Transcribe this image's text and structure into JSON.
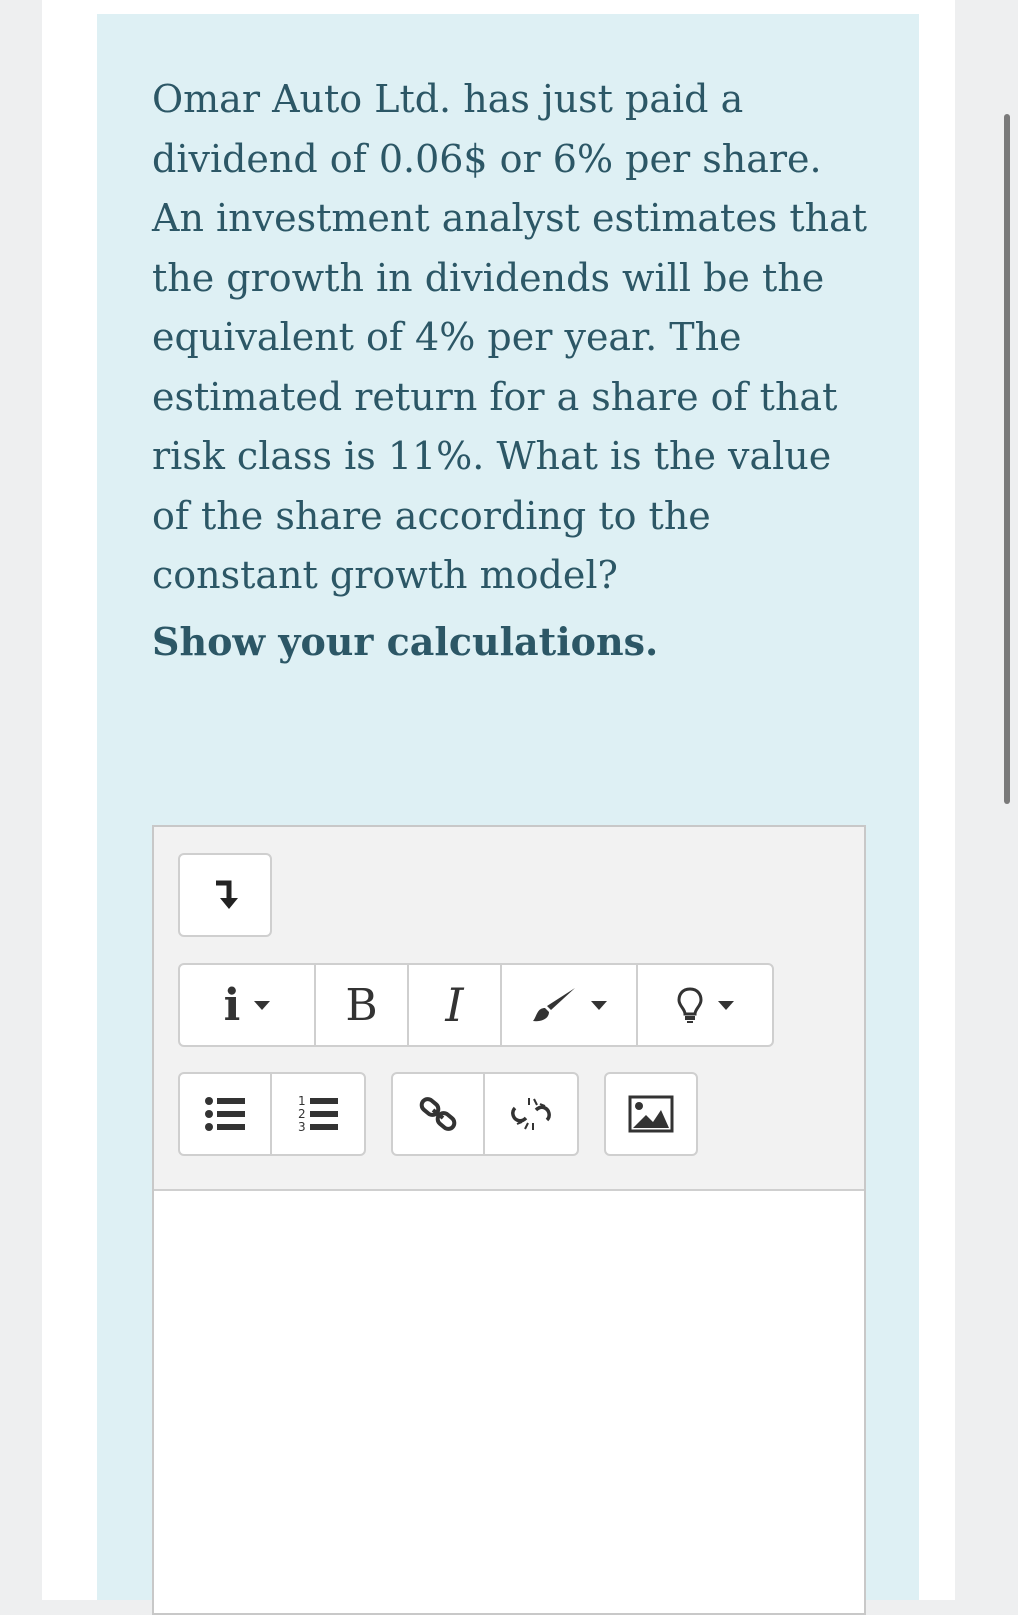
{
  "question": {
    "text": "Omar Auto Ltd. has just paid a dividend of 0.06$ or 6% per share. An investment analyst estimates that the growth in dividends will be the equivalent of 4% per year. The estimated return for a share of that risk class is 11%.  What is the value of the share according to the constant growth model?",
    "instruction": "Show your calculations."
  },
  "editor": {
    "toolbar": {
      "toggle_icon": "collapse-toolbar-icon",
      "row1": [
        {
          "icon": "info-icon",
          "label": "i",
          "dropdown": true
        },
        {
          "icon": "bold-icon",
          "label": "B"
        },
        {
          "icon": "italic-icon",
          "label": "I"
        },
        {
          "icon": "paint-brush-icon",
          "dropdown": true
        },
        {
          "icon": "lightbulb-icon",
          "dropdown": true
        }
      ],
      "row2": [
        {
          "icon": "unordered-list-icon"
        },
        {
          "icon": "ordered-list-icon"
        },
        {
          "icon": "link-icon"
        },
        {
          "icon": "unlink-icon"
        },
        {
          "icon": "image-icon"
        }
      ]
    },
    "content": ""
  },
  "colors": {
    "question_bg": "#def0f4",
    "text": "#2c5766",
    "toolbar_bg": "#f2f2f2",
    "page_bg": "#eeeff0"
  }
}
